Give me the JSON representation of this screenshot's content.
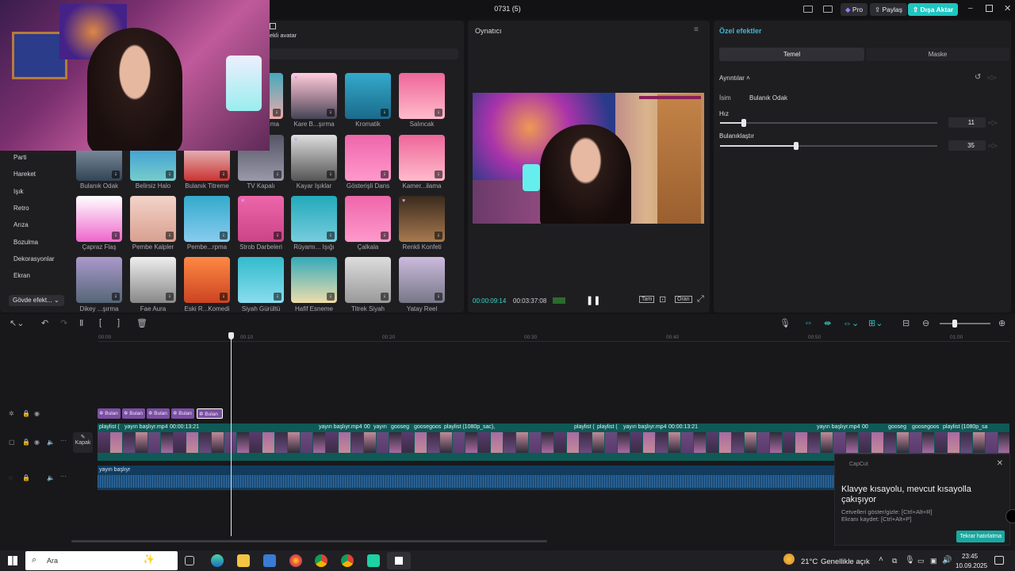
{
  "app": {
    "title": "0731 (5)",
    "pro_label": "Pro",
    "share_label": "Paylaş",
    "export_label": "Dışa Aktar",
    "accent": "#20c5c0",
    "effect_accent": "#3fb7d1"
  },
  "effects_panel": {
    "tab_label": "ekli avatar",
    "categories": [
      "Parti",
      "Hareket",
      "Işık",
      "Retro",
      "Arıza",
      "Bozulma",
      "Dekorasyonlar",
      "Ekran",
      "Gövde efekt..."
    ],
    "rows": [
      [
        "ışıma",
        "Kare B...şırma",
        "Kromatik",
        "Salıncak"
      ],
      [
        "Bulanık Odak",
        "Belirsiz Halo",
        "Bulanık Titreme",
        "TV Kapalı",
        "Kayar Işıklar",
        "Gösterişli Dans",
        "Kamer...ilama"
      ],
      [
        "Çapraz Flaş",
        "Pembe Kalpler",
        "Pembe...rpma",
        "Strob Darbeleri",
        "Rüyamı... Işığı",
        "Çalkala",
        "Renkli Konfeti"
      ],
      [
        "Dikey ...şırma",
        "Fae Aura",
        "Eski R...Komedi",
        "Siyah Gürültü",
        "Hafif Esneme",
        "Titrek Siyah",
        "Yatay Reel"
      ]
    ]
  },
  "player": {
    "title": "Oynatıcı",
    "current_time": "00:00:09:14",
    "total_time": "00:03:37:08",
    "full_label": "Tam",
    "ratio_label": "Oran"
  },
  "inspector": {
    "title": "Özel efektler",
    "tabs": [
      "Temel",
      "Maske"
    ],
    "section": "Ayrıntılar",
    "name_label": "İsim",
    "name_value": "Bulanık Odak",
    "speed_label": "Hız",
    "speed_value": "11",
    "speed_fraction": 0.11,
    "blur_label": "Bulanıklaştır",
    "blur_value": "35",
    "blur_fraction": 0.35
  },
  "timeline": {
    "ticks": [
      "00:00",
      "00:10",
      "00:20",
      "00:30",
      "00:40",
      "00:50",
      "01:00"
    ],
    "cover_label": "Kapak",
    "effect_clips": [
      "Bulan",
      "Bulan",
      "Bulan",
      "Bulan",
      "Bulan"
    ],
    "video_labels": [
      "playlist (",
      "yayın başlıyr.mp4",
      "00:00:13:21",
      "yayın başlıyr.mp4",
      "00",
      "yayın",
      "gooseg",
      "goosegoos",
      "playlist (1080p_sac),",
      "playlist (",
      "playlist (",
      "yayın başlıyr.mp4",
      "00:00:13:21",
      "yayın başlıyr.mp4",
      "00",
      "gooseg",
      "goosegoos",
      "playlist (1080p_sa"
    ],
    "audio_label": "yayın başlıyr"
  },
  "notification": {
    "app": "CapCut",
    "title": "Klavye kısayolu, mevcut kısayolla çakışıyor",
    "line1": "Cetvelleri göster/gizle: [Ctrl+Alt+R]",
    "line2": "Ekranı kaydet: [Ctrl+Alt+P]",
    "button": "Tekrar hatırlatma"
  },
  "taskbar": {
    "search_placeholder": "Ara",
    "weather": "21°C",
    "weather_text": "Genellikle açık",
    "time": "23:45",
    "date": "10.09.2025"
  }
}
